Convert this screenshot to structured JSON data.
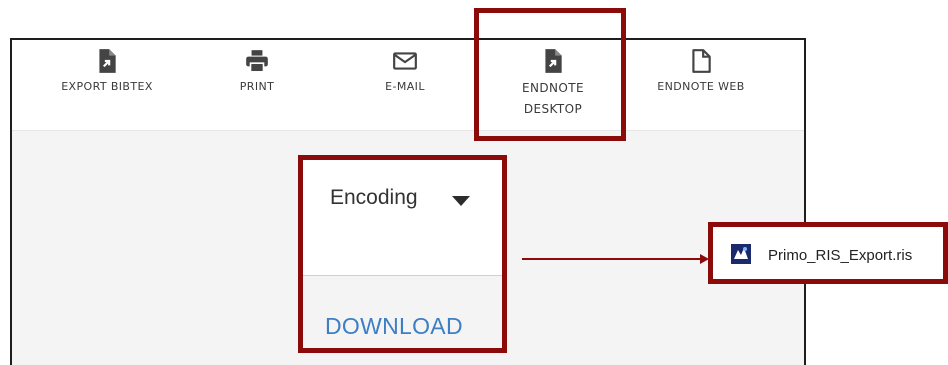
{
  "toolbar": {
    "items": [
      {
        "label": "EXPORT BIBTEX",
        "icon": "export-file-icon"
      },
      {
        "label": "PRINT",
        "icon": "printer-icon"
      },
      {
        "label": "E-MAIL",
        "icon": "envelope-icon"
      },
      {
        "label_line1": "ENDNOTE",
        "label_line2": "DESKTOP",
        "icon": "export-file-icon"
      },
      {
        "label": "ENDNOTE WEB",
        "icon": "document-icon"
      }
    ]
  },
  "encoding": {
    "label": "Encoding"
  },
  "download": {
    "label": "DOWNLOAD"
  },
  "file": {
    "name": "Primo_RIS_Export.ris",
    "icon": "ris-file-icon"
  },
  "colors": {
    "callout": "#8b0a0a",
    "link": "#3d7ec4",
    "icon": "#444444"
  }
}
